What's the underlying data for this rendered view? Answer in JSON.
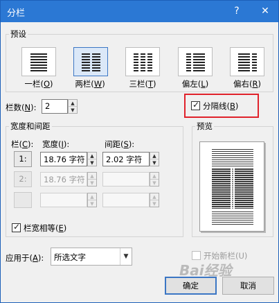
{
  "window": {
    "title": "分栏",
    "help_icon": "?",
    "close_icon": "✕"
  },
  "presets": {
    "group_label": "预设",
    "items": [
      {
        "label_prefix": "一栏(",
        "key": "O",
        "label_suffix": ")"
      },
      {
        "label_prefix": "两栏(",
        "key": "W",
        "label_suffix": ")"
      },
      {
        "label_prefix": "三栏(",
        "key": "T",
        "label_suffix": ")"
      },
      {
        "label_prefix": "偏左(",
        "key": "L",
        "label_suffix": ")"
      },
      {
        "label_prefix": "偏右(",
        "key": "R",
        "label_suffix": ")"
      }
    ],
    "selected": "两栏"
  },
  "columns_count": {
    "label_prefix": "栏数(",
    "key": "N",
    "label_suffix": "):",
    "value": "2"
  },
  "line_between": {
    "label_prefix": "分隔线(",
    "key": "B",
    "label_suffix": ")",
    "checked": true
  },
  "width_spacing": {
    "group_label": "宽度和间距",
    "col_header_prefix": "栏(",
    "col_header_key": "C",
    "col_header_suffix": "):",
    "width_header_prefix": "宽度(",
    "width_header_key": "I",
    "width_header_suffix": "):",
    "spacing_header_prefix": "间距(",
    "spacing_header_key": "S",
    "spacing_header_suffix": "):",
    "rows": [
      {
        "col": "1:",
        "width": "18.76 字符",
        "spacing": "2.02 字符",
        "enabled": true
      },
      {
        "col": "2:",
        "width": "18.76 字符",
        "spacing": "",
        "enabled": false
      },
      {
        "col": "",
        "width": "",
        "spacing": "",
        "enabled": false
      }
    ],
    "equal_width_prefix": "栏宽相等(",
    "equal_width_key": "E",
    "equal_width_suffix": ")",
    "equal_width_checked": true
  },
  "preview": {
    "group_label": "预览"
  },
  "apply_to": {
    "label_prefix": "应用于(",
    "key": "A",
    "label_suffix": "):",
    "value": "所选文字"
  },
  "new_column": {
    "label": "开始新栏(U)",
    "checked": false,
    "enabled": false
  },
  "buttons": {
    "ok": "确定",
    "cancel": "取消"
  },
  "watermark": "Bai经验",
  "colors": {
    "titlebar": "#2b78d4",
    "highlight_box": "#e0212a",
    "selected_preset": "#dbe8f8"
  }
}
